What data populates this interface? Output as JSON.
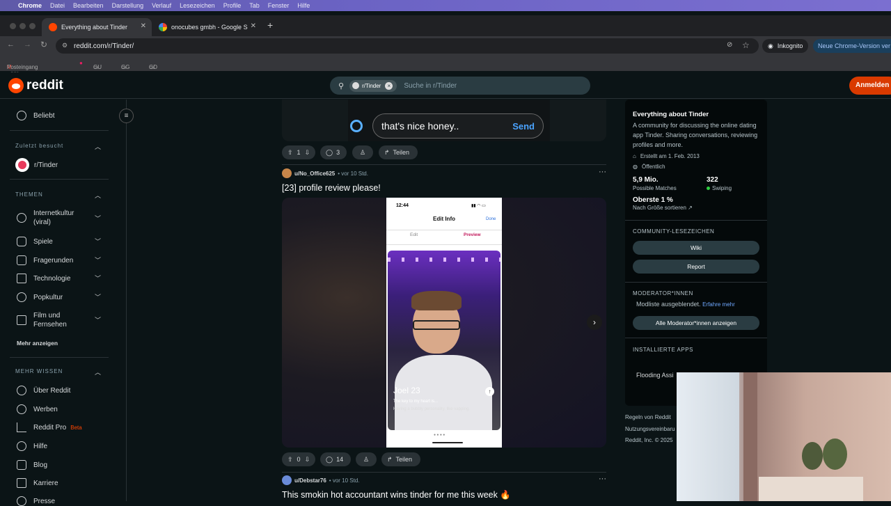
{
  "menubar": {
    "items": [
      "Chrome",
      "Datei",
      "Bearbeiten",
      "Darstellung",
      "Verlauf",
      "Lesezeichen",
      "Profile",
      "Tab",
      "Fenster",
      "Hilfe"
    ]
  },
  "tabs": [
    {
      "title": "Everything about Tinder",
      "active": true
    },
    {
      "title": "onocubes gmbh - Google Su",
      "active": false
    }
  ],
  "address": {
    "url": "reddit.com/r/Tinder/",
    "incognito": "Inkognito",
    "update": "Neue Chrome-Version ver"
  },
  "bookmarks": [
    "Posteingang - ger...",
    "GU",
    "GG",
    "GD"
  ],
  "header": {
    "logo": "reddit",
    "subreddit_chip": "r/Tinder",
    "search_placeholder": "Suche in r/Tinder",
    "login": "Anmelden"
  },
  "leftnav": {
    "beliebt": "Beliebt",
    "recent_label": "Zuletzt besucht",
    "recent_item": "r/Tinder",
    "themen_label": "THEMEN",
    "themen": [
      "Internetkultur (viral)",
      "Spiele",
      "Fragerunden",
      "Technologie",
      "Popkultur",
      "Film und Fernsehen"
    ],
    "more": "Mehr anzeigen",
    "mehr_label": "MEHR WISSEN",
    "mehr": [
      "Über Reddit",
      "Werben",
      "Reddit Pro",
      "Hilfe",
      "Blog",
      "Karriere",
      "Presse"
    ],
    "beta": "Beta"
  },
  "feed": {
    "chat_message": "that's nice honey..",
    "chat_send": "Send",
    "post0": {
      "votes": "1",
      "comments": "3",
      "share": "Teilen"
    },
    "post1": {
      "user": "u/No_Office625",
      "time": "vor 10 Std.",
      "title": "[23] profile review please!",
      "votes": "0",
      "comments": "14",
      "share": "Teilen",
      "phone": {
        "time": "12:44",
        "header": "Edit Info",
        "done": "Done",
        "tab_edit": "Edit",
        "tab_preview": "Preview",
        "name": "Joel",
        "age": "23",
        "prompt": "The key to my heart is...",
        "prompt_answer": "Having a bubbly personality, like vapping."
      }
    },
    "post2": {
      "user": "u/Debstar76",
      "time": "vor 10 Std.",
      "title": "This smokin hot accountant wins tinder for me this week 🔥"
    }
  },
  "sidebar": {
    "title": "Everything about Tinder",
    "description": "A community for discussing the online dating app Tinder. Sharing conversations, reviewing profiles and more.",
    "created": "Erstellt am 1. Feb. 2013",
    "visibility": "Öffentlich",
    "members": "5,9 Mio.",
    "members_label": "Possible Matches",
    "online": "322",
    "online_label": "Swiping",
    "rank": "Oberste 1 %",
    "rank_sub": "Nach Größe sortieren",
    "bookmarks_label": "COMMUNITY-LESEZEICHEN",
    "bookmark_btns": [
      "Wiki",
      "Report"
    ],
    "mods_label": "MODERATOR*INNEN",
    "mods_hidden": "Modliste ausgeblendet.",
    "mods_link": "Erfahre mehr",
    "mods_btn": "Alle Moderator*innen anzeigen",
    "apps_label": "INSTALLIERTE APPS",
    "app_item": "Flooding Assi"
  },
  "footer": [
    "Regeln von Reddit",
    "Nutzungsvereinbaru",
    "Reddit, Inc. © 2025"
  ],
  "colors": {
    "bg": "#0b1416",
    "accent": "#ff4500",
    "login": "#d93a00"
  }
}
